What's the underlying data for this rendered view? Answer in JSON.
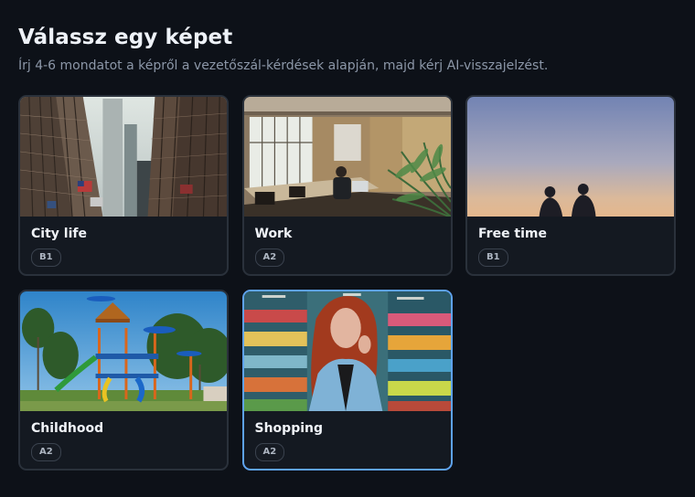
{
  "header": {
    "title": "Válassz egy képet",
    "subtitle": "Írj 4-6 mondatot a képről a vezetőszál-kérdések alapján, majd kérj AI-visszajelzést."
  },
  "cards": [
    {
      "title": "City life",
      "level": "B1",
      "image": "city-street-photo"
    },
    {
      "title": "Work",
      "level": "A2",
      "image": "office-photo"
    },
    {
      "title": "Free time",
      "level": "B1",
      "image": "sunset-silhouettes-photo"
    },
    {
      "title": "Childhood",
      "level": "A2",
      "image": "playground-photo"
    },
    {
      "title": "Shopping",
      "level": "A2",
      "image": "supermarket-portrait-photo",
      "selected": true
    }
  ],
  "colors": {
    "background": "#0d1118",
    "card": "#141921",
    "card_border": "#2a313b",
    "selected_border": "#5ea2ee"
  }
}
